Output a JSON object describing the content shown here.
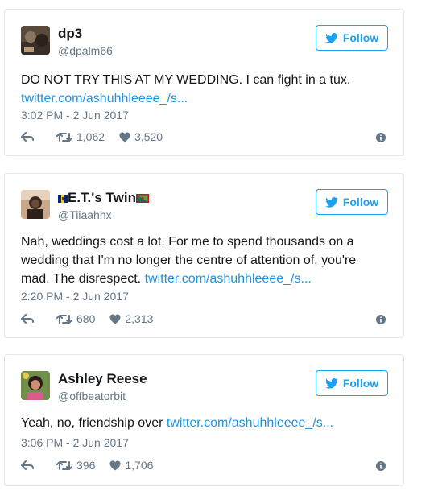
{
  "follow_label": "Follow",
  "tweets": [
    {
      "name": "dp3",
      "handle": "@dpalm66",
      "text": "DO NOT TRY THIS AT MY WEDDING. I can fight in a tux.",
      "link": "twitter.com/ashuhhleeee_/s...",
      "time": "3:02 PM - 2 Jun 2017",
      "retweets": "1,062",
      "likes": "3,520"
    },
    {
      "name": "E.T.'s Twin",
      "handle": "@Tiiaahhx",
      "text": "Nah, weddings cost a lot. For me to spend thousands on a wedding that I'm no longer the centre of attention of, you're mad. The disrespect.",
      "link": "twitter.com/ashuhhleeee_/s...",
      "time": "2:20 PM - 2 Jun 2017",
      "retweets": "680",
      "likes": "2,313"
    },
    {
      "name": "Ashley Reese",
      "handle": "@offbeatorbit",
      "text": "Yeah, no, friendship over",
      "link": "twitter.com/ashuhhleeee_/s...",
      "time": "3:06 PM - 2 Jun 2017",
      "retweets": "396",
      "likes": "1,706"
    }
  ],
  "icons": {
    "reply": "reply-icon",
    "retweet": "retweet-icon",
    "like": "heart-icon",
    "info": "info-icon",
    "follow": "twitter-bird-icon"
  },
  "colors": {
    "accent": "#1da1f2",
    "link": "#1b95e0",
    "muted": "#657786",
    "border": "#e1e8ed"
  }
}
